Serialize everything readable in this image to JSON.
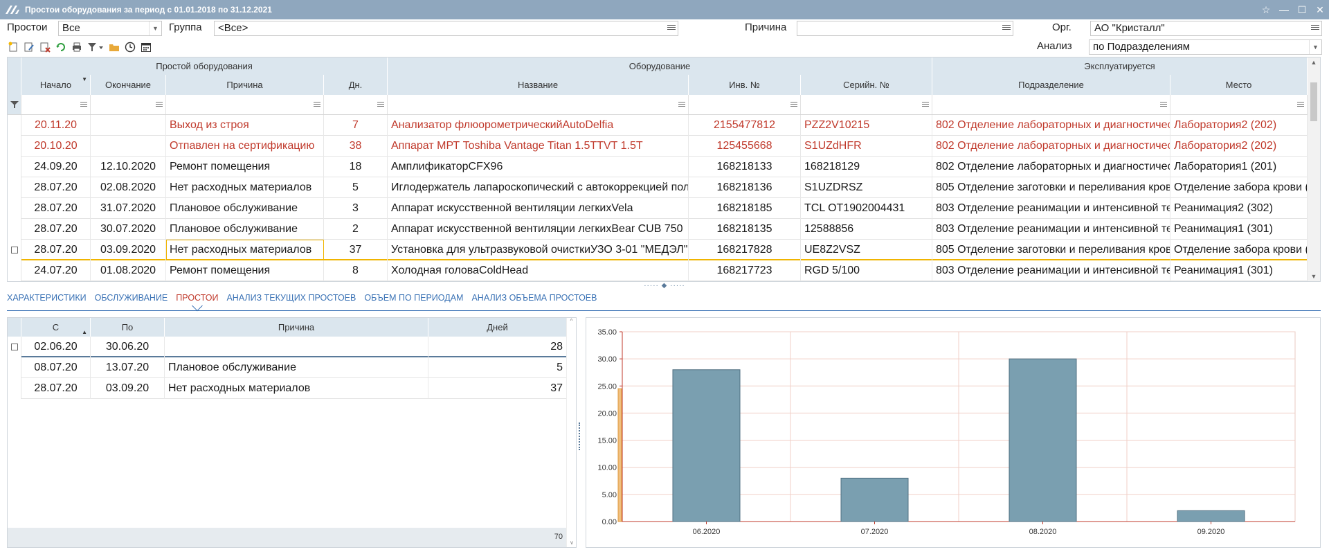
{
  "window": {
    "title": "Простои оборудования за период с 01.01.2018 по 31.12.2021"
  },
  "filters": {
    "prostoi_label": "Простои",
    "prostoi_value": "Все",
    "gruppa_label": "Группа",
    "gruppa_value": "<Все>",
    "prichina_label": "Причина",
    "prichina_value": "",
    "org_label": "Орг.",
    "org_value": "АО \"Кристалл\"",
    "analiz_label": "Анализ",
    "analiz_value": "по Подразделениям"
  },
  "grid": {
    "groups": [
      "Простой оборудования",
      "Оборудование",
      "Эксплуатируется"
    ],
    "columns": [
      "Начало",
      "Окончание",
      "Причина",
      "Дн.",
      "Название",
      "Инв. №",
      "Серийн. №",
      "Подразделение",
      "Место"
    ],
    "rows": [
      {
        "start": "20.11.20",
        "end": "",
        "reason": "Выход из строя",
        "days": "7",
        "name": "Анализатор флюорометрическийAutoDelfia",
        "inv": "2155477812",
        "serial": "PZZ2V10215",
        "dept": "802 Отделение лабораторных и диагностичес",
        "place": "Лаборатория2 (202)"
      },
      {
        "start": "20.10.20",
        "end": "",
        "reason": "Отпавлен на сертификацию",
        "days": "38",
        "name": "Аппарат МРТ Toshiba Vantage Titan 1.5TTVT 1.5T",
        "inv": "125455668",
        "serial": "S1UZdHFR",
        "dept": "802 Отделение лабораторных и диагностичес",
        "place": "Лаборатория2 (202)"
      },
      {
        "start": "24.09.20",
        "end": "12.10.2020",
        "reason": "Ремонт помещения",
        "days": "18",
        "name": "АмплификаторCFX96",
        "inv": "168218133",
        "serial": "168218129",
        "dept": "802 Отделение лабораторных и диагностичес",
        "place": "Лаборатория1 (201)"
      },
      {
        "start": "28.07.20",
        "end": "02.08.2020",
        "reason": "Нет расходных материалов",
        "days": "5",
        "name": "Иглодержатель лапароскопический с автокоррекцией пол",
        "inv": "168218136",
        "serial": "S1UZDRSZ",
        "dept": "805 Отделение заготовки и переливания кров",
        "place": "Отделение забора крови (4"
      },
      {
        "start": "28.07.20",
        "end": "31.07.2020",
        "reason": "Плановое обслуживание",
        "days": "3",
        "name": "Аппарат искусственной вентиляции легкихVela",
        "inv": "168218185",
        "serial": "TCL OT1902004431",
        "dept": "803 Отделение  реанимации и интенсивной те",
        "place": "Реанимация2 (302)"
      },
      {
        "start": "28.07.20",
        "end": "30.07.2020",
        "reason": "Плановое обслуживание",
        "days": "2",
        "name": "Аппарат искусственной вентиляции легкихBear CUB 750",
        "inv": "168218135",
        "serial": "12588856",
        "dept": "803 Отделение  реанимации и интенсивной те",
        "place": "Реанимация1 (301)"
      },
      {
        "start": "28.07.20",
        "end": "03.09.2020",
        "reason": "Нет расходных материалов",
        "days": "37",
        "name": "Установка для ультразвуковой очисткиУЗО 3-01 \"МЕДЭЛ\"",
        "inv": "168217828",
        "serial": "UE8Z2VSZ",
        "dept": "805 Отделение заготовки и переливания кров",
        "place": "Отделение забора крови (4"
      },
      {
        "start": "24.07.20",
        "end": "01.08.2020",
        "reason": "Ремонт помещения",
        "days": "8",
        "name": "Холодная головаColdHead",
        "inv": "168217723",
        "serial": "RGD 5/100",
        "dept": "803 Отделение  реанимации и интенсивной те",
        "place": "Реанимация1 (301)"
      }
    ]
  },
  "tabs": [
    "Характеристики",
    "Обслуживание",
    "Простои",
    "Анализ текущих простоев",
    "Объем по периодам",
    "Анализ объема простоев"
  ],
  "active_tab": "Простои",
  "subgrid": {
    "columns": [
      "С",
      "По",
      "Причина",
      "Дней"
    ],
    "rows": [
      {
        "from": "02.06.20",
        "to": "30.06.20",
        "reason": "",
        "days": "28"
      },
      {
        "from": "08.07.20",
        "to": "13.07.20",
        "reason": "Плановое обслуживание",
        "days": "5"
      },
      {
        "from": "28.07.20",
        "to": "03.09.20",
        "reason": "Нет расходных материалов",
        "days": "37"
      }
    ],
    "total": "70"
  },
  "chart_data": {
    "type": "bar",
    "categories": [
      "06.2020",
      "07.2020",
      "08.2020",
      "09.2020"
    ],
    "values": [
      28,
      8,
      30,
      2
    ],
    "ylim": [
      0,
      35
    ],
    "yticks": [
      "0.00",
      "5.00",
      "10.00",
      "15.00",
      "20.00",
      "25.00",
      "30.00",
      "35.00"
    ],
    "xlabel": "",
    "ylabel": "",
    "title": "",
    "bar_color": "#7a9fb0",
    "grid": true
  },
  "colors": {
    "accent": "#3a72b5",
    "alert": "#c0392b",
    "header": "#dbe6ee",
    "titlebar": "#8fa7be"
  }
}
